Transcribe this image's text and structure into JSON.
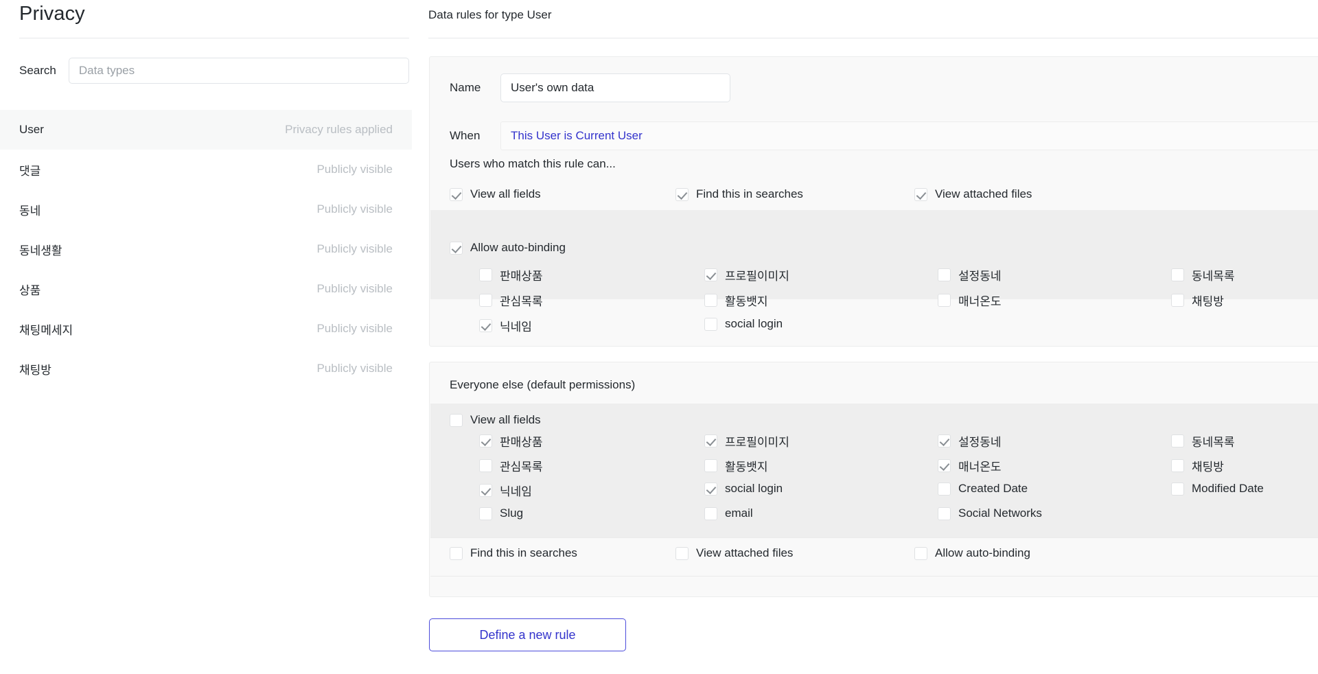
{
  "sidebar": {
    "title": "Privacy",
    "search": {
      "label": "Search",
      "placeholder": "Data types",
      "value": ""
    },
    "items": [
      {
        "name": "User",
        "status": "Privacy rules applied",
        "selected": true
      },
      {
        "name": "댓글",
        "status": "Publicly visible",
        "selected": false
      },
      {
        "name": "동네",
        "status": "Publicly visible",
        "selected": false
      },
      {
        "name": "동네생활",
        "status": "Publicly visible",
        "selected": false
      },
      {
        "name": "상품",
        "status": "Publicly visible",
        "selected": false
      },
      {
        "name": "채팅메세지",
        "status": "Publicly visible",
        "selected": false
      },
      {
        "name": "채팅방",
        "status": "Publicly visible",
        "selected": false
      }
    ]
  },
  "main": {
    "header": "Data rules for type User",
    "rule": {
      "name_label": "Name",
      "name_value": "User's own data",
      "when_label": "When",
      "when_value": "This User is Current User",
      "caption": "Users who match this rule can...",
      "top_permissions": [
        {
          "label": "View all fields",
          "checked": true
        },
        {
          "label": "Find this in searches",
          "checked": true
        },
        {
          "label": "View attached files",
          "checked": true
        }
      ],
      "auto_binding": {
        "label": "Allow auto-binding",
        "checked": true
      },
      "fields": [
        {
          "label": "판매상품",
          "checked": false,
          "col": 0,
          "row": 0
        },
        {
          "label": "프로필이미지",
          "checked": true,
          "col": 1,
          "row": 0
        },
        {
          "label": "설정동네",
          "checked": false,
          "col": 2,
          "row": 0
        },
        {
          "label": "동네목록",
          "checked": false,
          "col": 3,
          "row": 0
        },
        {
          "label": "관심목록",
          "checked": false,
          "col": 0,
          "row": 1
        },
        {
          "label": "활동뱃지",
          "checked": false,
          "col": 1,
          "row": 1
        },
        {
          "label": "매너온도",
          "checked": false,
          "col": 2,
          "row": 1
        },
        {
          "label": "채팅방",
          "checked": false,
          "col": 3,
          "row": 1
        },
        {
          "label": "닉네임",
          "checked": true,
          "col": 0,
          "row": 2
        },
        {
          "label": "social login",
          "checked": false,
          "col": 1,
          "row": 2
        }
      ]
    },
    "everyone": {
      "caption": "Everyone else (default permissions)",
      "view_all_fields": {
        "label": "View all fields",
        "checked": false
      },
      "fields": [
        {
          "label": "판매상품",
          "checked": true,
          "col": 0,
          "row": 0
        },
        {
          "label": "프로필이미지",
          "checked": true,
          "col": 1,
          "row": 0
        },
        {
          "label": "설정동네",
          "checked": true,
          "col": 2,
          "row": 0
        },
        {
          "label": "동네목록",
          "checked": false,
          "col": 3,
          "row": 0
        },
        {
          "label": "관심목록",
          "checked": false,
          "col": 0,
          "row": 1
        },
        {
          "label": "활동뱃지",
          "checked": false,
          "col": 1,
          "row": 1
        },
        {
          "label": "매너온도",
          "checked": true,
          "col": 2,
          "row": 1
        },
        {
          "label": "채팅방",
          "checked": false,
          "col": 3,
          "row": 1
        },
        {
          "label": "닉네임",
          "checked": true,
          "col": 0,
          "row": 2
        },
        {
          "label": "social login",
          "checked": true,
          "col": 1,
          "row": 2
        },
        {
          "label": "Created Date",
          "checked": false,
          "col": 2,
          "row": 2
        },
        {
          "label": "Modified Date",
          "checked": false,
          "col": 3,
          "row": 2
        },
        {
          "label": "Slug",
          "checked": false,
          "col": 0,
          "row": 3
        },
        {
          "label": "email",
          "checked": false,
          "col": 1,
          "row": 3
        },
        {
          "label": "Social Networks",
          "checked": false,
          "col": 2,
          "row": 3
        }
      ],
      "bottom_permissions": [
        {
          "label": "Find this in searches",
          "checked": false
        },
        {
          "label": "View attached files",
          "checked": false
        },
        {
          "label": "Allow auto-binding",
          "checked": false
        }
      ]
    },
    "define_button": "Define a new rule"
  },
  "colors": {
    "link": "#3333cc",
    "text": "#24292e",
    "muted": "#b9bec3",
    "panel_bg": "#f9f9f9",
    "strip_shade": "#eeeeee",
    "border": "#e1e4e8"
  }
}
